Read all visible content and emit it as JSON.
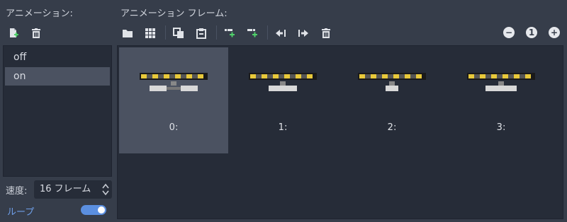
{
  "left_title": "アニメーション:",
  "frames_title": "アニメーション フレーム:",
  "animations": [
    {
      "label": "off",
      "selected": false
    },
    {
      "label": "on",
      "selected": true
    }
  ],
  "speed": {
    "label": "速度:",
    "value": "16 フレーム"
  },
  "loop": {
    "label": "ループ",
    "enabled": true
  },
  "frames": [
    {
      "label": "0:",
      "selected": true
    },
    {
      "label": "1:",
      "selected": false
    },
    {
      "label": "2:",
      "selected": false
    },
    {
      "label": "3:",
      "selected": false
    }
  ],
  "zoom": {
    "out": "−",
    "reset": "1",
    "in": "+"
  },
  "toolbar_icons": {
    "left": [
      "new-animation-icon",
      "delete-animation-icon"
    ],
    "frames": [
      "load-folder-icon",
      "load-sheet-icon",
      "copy-icon",
      "paste-icon",
      "insert-before-icon",
      "insert-after-icon",
      "move-left-icon",
      "move-right-icon",
      "delete-frame-icon"
    ]
  },
  "colors": {
    "background": "#363d4a",
    "panel": "#262c38",
    "selection": "#4b5261",
    "accent": "#5b8fe0",
    "loop_label": "#6e9ee8",
    "stripe_yellow": "#e8c93a",
    "add_green": "#4fd06a"
  }
}
